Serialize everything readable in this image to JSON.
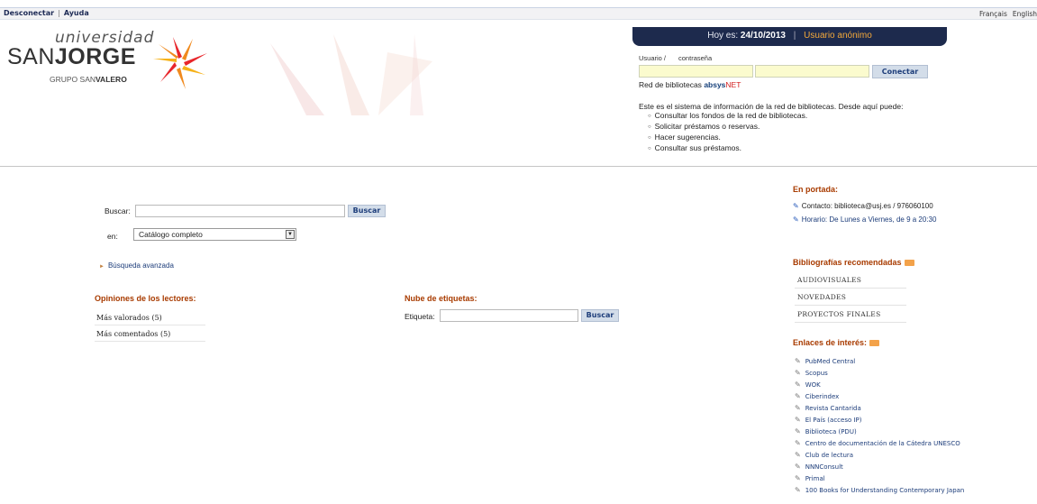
{
  "topbar": {
    "logout": "Desconectar",
    "help": "Ayuda",
    "lang_fr": "Français",
    "lang_en": "English"
  },
  "logo": {
    "line1": "universidad",
    "line2_a": "SAN",
    "line2_b": "JORGE",
    "line3_a": "GRUPO SAN",
    "line3_b": "VALERO"
  },
  "datebar": {
    "prefix": "Hoy es:",
    "date": "24/10/2013",
    "user": "Usuario anónimo"
  },
  "login": {
    "user_label": "Usuario /",
    "pass_label": "contraseña",
    "connect": "Conectar"
  },
  "network": {
    "prefix": "Red de bibliotecas",
    "brand_a": "absys",
    "brand_b": "NET"
  },
  "info": {
    "intro": "Este es el sistema de información de la red de bibliotecas. Desde aquí puede:",
    "items": [
      "Consultar los fondos de la red de bibliotecas.",
      "Solicitar préstamos o reservas.",
      "Hacer sugerencias.",
      "Consultar sus préstamos."
    ]
  },
  "search": {
    "label": "Buscar:",
    "button": "Buscar",
    "in_label": "en:",
    "scope": "Catálogo completo",
    "advanced": "Búsqueda avanzada"
  },
  "opinions": {
    "title": "Opiniones de los lectores:",
    "items": [
      "Más valorados (5)",
      "Más comentados (5)"
    ]
  },
  "tags": {
    "title": "Nube de etiquetas:",
    "label": "Etiqueta:",
    "button": "Buscar"
  },
  "portada": {
    "title": "En portada:",
    "items": [
      "Contacto: biblioteca@usj.es / 976060100",
      "Horario: De Lunes a Viernes, de 9 a 20:30"
    ]
  },
  "biblios": {
    "title": "Bibliografías recomendadas",
    "items": [
      "AUDIOVISUALES",
      "NOVEDADES",
      "PROYECTOS FINALES"
    ]
  },
  "links": {
    "title": "Enlaces de interés:",
    "items": [
      "PubMed Central",
      "Scopus",
      "WOK",
      "Ciberindex",
      "Revista Cantarida",
      "El País (acceso IP)",
      "Biblioteca (PDU)",
      "Centro de documentación de la Cátedra UNESCO",
      "Club de lectura",
      "NNNConsult",
      "Primal",
      "100 Books for Understanding Contemporary Japan"
    ]
  },
  "colors": {
    "navy": "#1d2a4d",
    "orange": "#f4a93a",
    "section_title": "#a83b00",
    "button_bg": "#d3dde9",
    "input_yellow": "#fbfbce"
  }
}
